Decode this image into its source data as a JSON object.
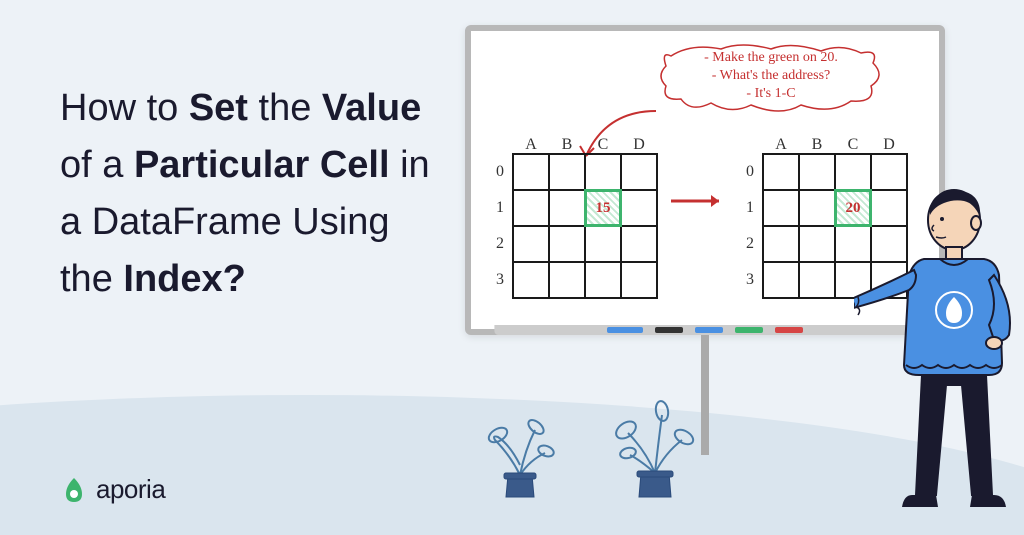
{
  "title": {
    "parts": [
      {
        "text": "How to ",
        "bold": false
      },
      {
        "text": "Set",
        "bold": true
      },
      {
        "text": " the ",
        "bold": false
      },
      {
        "text": "Value",
        "bold": true
      },
      {
        "text": " of a ",
        "bold": false
      },
      {
        "text": "Particular Cell",
        "bold": true
      },
      {
        "text": " in a DataFrame Using the ",
        "bold": false
      },
      {
        "text": "Index?",
        "bold": true
      }
    ]
  },
  "logo": {
    "text": "aporia"
  },
  "whiteboard": {
    "bubble": {
      "line1": "- Make the green on 20.",
      "line2": "- What's the address?",
      "line3": "- It's 1-C"
    },
    "columns": [
      "A",
      "B",
      "C",
      "D"
    ],
    "rows": [
      "0",
      "1",
      "2",
      "3"
    ],
    "grid_left": {
      "highlight": {
        "row": 1,
        "col": 2,
        "value": "15"
      }
    },
    "grid_right": {
      "highlight": {
        "row": 1,
        "col": 2,
        "value": "20"
      }
    }
  },
  "colors": {
    "accent_red": "#c53030",
    "accent_green": "#3db46d",
    "accent_blue": "#4a90e2",
    "background": "#edf2f7",
    "wave": "#dae5ee"
  }
}
